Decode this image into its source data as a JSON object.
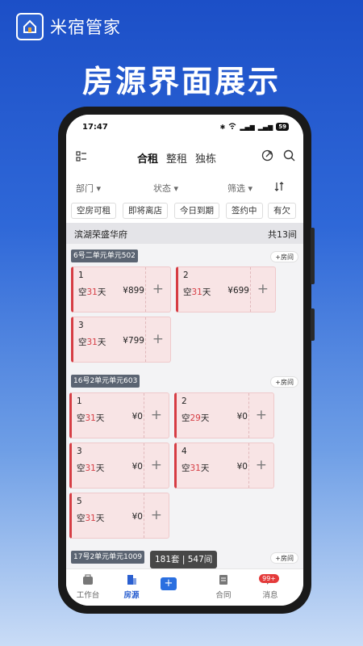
{
  "brand": {
    "name": "米宿管家"
  },
  "headline": "房源界面展示",
  "status": {
    "time": "17:47",
    "battery": "59"
  },
  "nav": {
    "tabs": [
      "合租",
      "整租",
      "独栋"
    ]
  },
  "filters": [
    "部门",
    "状态",
    "筛选"
  ],
  "quick": [
    "空房可租",
    "即将离店",
    "今日到期",
    "签约中",
    "有欠"
  ],
  "building": {
    "name": "滨湖荣盛华府",
    "count": "共13间"
  },
  "groups": [
    {
      "label": "6号二单元单元502",
      "add": "+房间",
      "rooms": [
        {
          "num": "1",
          "vac_prefix": "空",
          "days": "31",
          "vac_suffix": "天",
          "price": "¥899"
        },
        {
          "num": "2",
          "vac_prefix": "空",
          "days": "31",
          "vac_suffix": "天",
          "price": "¥699"
        },
        {
          "num": "3",
          "vac_prefix": "空",
          "days": "31",
          "vac_suffix": "天",
          "price": "¥799"
        }
      ]
    },
    {
      "label": "16号2单元单元603",
      "add": "+房间",
      "rooms": [
        {
          "num": "1",
          "vac_prefix": "空",
          "days": "31",
          "vac_suffix": "天",
          "price": "¥0"
        },
        {
          "num": "2",
          "vac_prefix": "空",
          "days": "29",
          "vac_suffix": "天",
          "price": "¥0"
        },
        {
          "num": "3",
          "vac_prefix": "空",
          "days": "31",
          "vac_suffix": "天",
          "price": "¥0"
        },
        {
          "num": "4",
          "vac_prefix": "空",
          "days": "31",
          "vac_suffix": "天",
          "price": "¥0"
        },
        {
          "num": "5",
          "vac_prefix": "空",
          "days": "31",
          "vac_suffix": "天",
          "price": "¥0"
        }
      ]
    },
    {
      "label": "17号2单元单元1009",
      "add": "+房间",
      "rooms": []
    }
  ],
  "toast": "181套 | 547间",
  "bottom": {
    "items": [
      "工作台",
      "房源",
      "合同",
      "消息"
    ],
    "badge": "99+"
  }
}
